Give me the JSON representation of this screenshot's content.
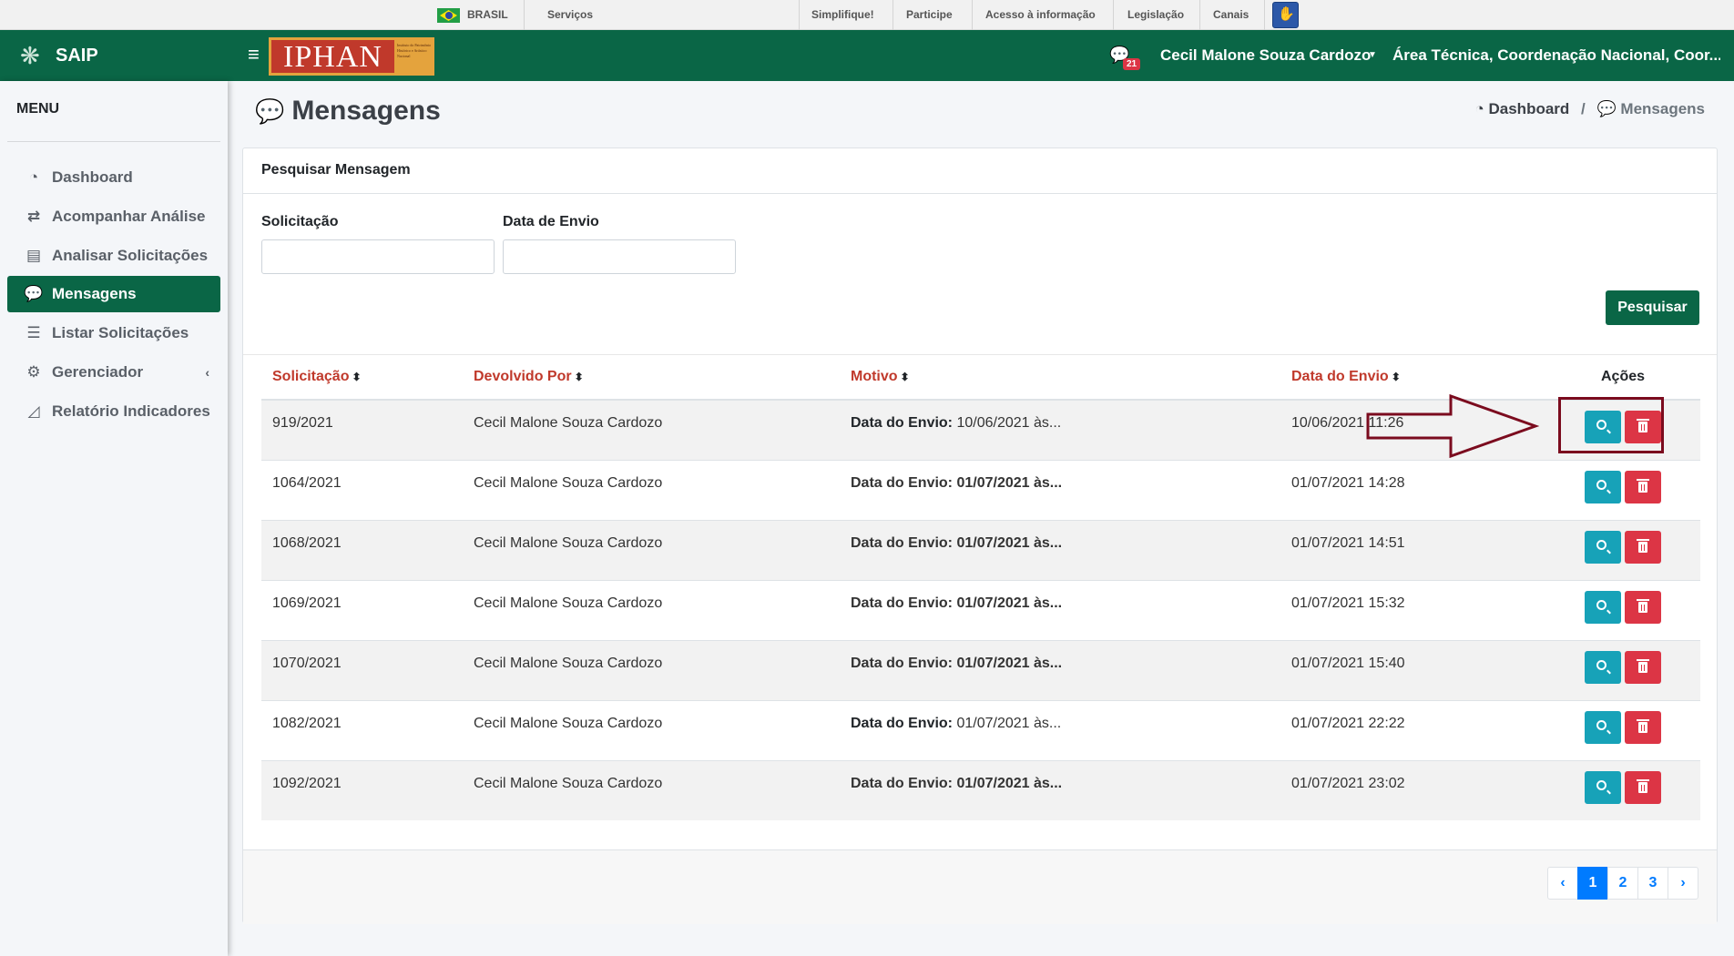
{
  "gov_bar": {
    "country": "BRASIL",
    "links": [
      "Serviços",
      "Simplifique!",
      "Participe",
      "Acesso à informação",
      "Legislação",
      "Canais"
    ]
  },
  "header": {
    "app_name": "SAIP",
    "logo_text": "IPHAN",
    "logo_subtext": "Instituto do Patrimônio Histórico e Artístico Nacional",
    "message_badge": "21",
    "user_name": "Cecil Malone Souza Cardozo",
    "department": "Área Técnica, Coordenação Nacional, Coor..."
  },
  "sidebar": {
    "title": "MENU",
    "items": [
      {
        "label": "Dashboard",
        "icon": "tachometer-icon"
      },
      {
        "label": "Acompanhar Análise",
        "icon": "exchange-icon"
      },
      {
        "label": "Analisar Solicitações",
        "icon": "book-icon"
      },
      {
        "label": "Mensagens",
        "icon": "comments-icon"
      },
      {
        "label": "Listar Solicitações",
        "icon": "list-icon"
      },
      {
        "label": "Gerenciador",
        "icon": "cogs-icon"
      },
      {
        "label": "Relatório Indicadores",
        "icon": "area-chart-icon"
      }
    ],
    "active_index": 3
  },
  "page": {
    "title": "Mensagens",
    "breadcrumb": [
      "Dashboard",
      "/",
      "Mensagens"
    ]
  },
  "search": {
    "card_title": "Pesquisar Mensagem",
    "field_solicitacao_label": "Solicitação",
    "field_solicitacao_value": "",
    "field_data_label": "Data de Envio",
    "field_data_value": "",
    "button_label": "Pesquisar"
  },
  "table": {
    "columns": [
      "Solicitação",
      "Devolvido Por",
      "Motivo",
      "Data do Envio",
      "Ações"
    ],
    "rows": [
      {
        "solicitacao": "919/2021",
        "devolvido_por": "Cecil Malone Souza Cardozo",
        "motivo_label": "Data do Envio:",
        "motivo_value": "10/06/2021 às...",
        "motivo_bold": false,
        "data_envio": "10/06/2021 11:26"
      },
      {
        "solicitacao": "1064/2021",
        "devolvido_por": "Cecil Malone Souza Cardozo",
        "motivo_label": "Data do Envio:",
        "motivo_value": "01/07/2021 às...",
        "motivo_bold": true,
        "data_envio": "01/07/2021 14:28"
      },
      {
        "solicitacao": "1068/2021",
        "devolvido_por": "Cecil Malone Souza Cardozo",
        "motivo_label": "Data do Envio:",
        "motivo_value": "01/07/2021 às...",
        "motivo_bold": true,
        "data_envio": "01/07/2021 14:51"
      },
      {
        "solicitacao": "1069/2021",
        "devolvido_por": "Cecil Malone Souza Cardozo",
        "motivo_label": "Data do Envio:",
        "motivo_value": "01/07/2021 às...",
        "motivo_bold": true,
        "data_envio": "01/07/2021 15:32"
      },
      {
        "solicitacao": "1070/2021",
        "devolvido_por": "Cecil Malone Souza Cardozo",
        "motivo_label": "Data do Envio:",
        "motivo_value": "01/07/2021 às...",
        "motivo_bold": true,
        "data_envio": "01/07/2021 15:40"
      },
      {
        "solicitacao": "1082/2021",
        "devolvido_por": "Cecil Malone Souza Cardozo",
        "motivo_label": "Data do Envio:",
        "motivo_value": "01/07/2021 às...",
        "motivo_bold": false,
        "data_envio": "01/07/2021 22:22"
      },
      {
        "solicitacao": "1092/2021",
        "devolvido_por": "Cecil Malone Souza Cardozo",
        "motivo_label": "Data do Envio:",
        "motivo_value": "01/07/2021 às...",
        "motivo_bold": true,
        "data_envio": "01/07/2021 23:02"
      }
    ]
  },
  "pagination": {
    "prev": "‹",
    "pages": [
      "1",
      "2",
      "3"
    ],
    "current": "1",
    "next": "›"
  },
  "colors": {
    "brand_green": "#0a6646",
    "header_red": "#c0392b",
    "view_button": "#17a2b8",
    "delete_button": "#dc3545",
    "annotation": "#7b0b1e"
  }
}
